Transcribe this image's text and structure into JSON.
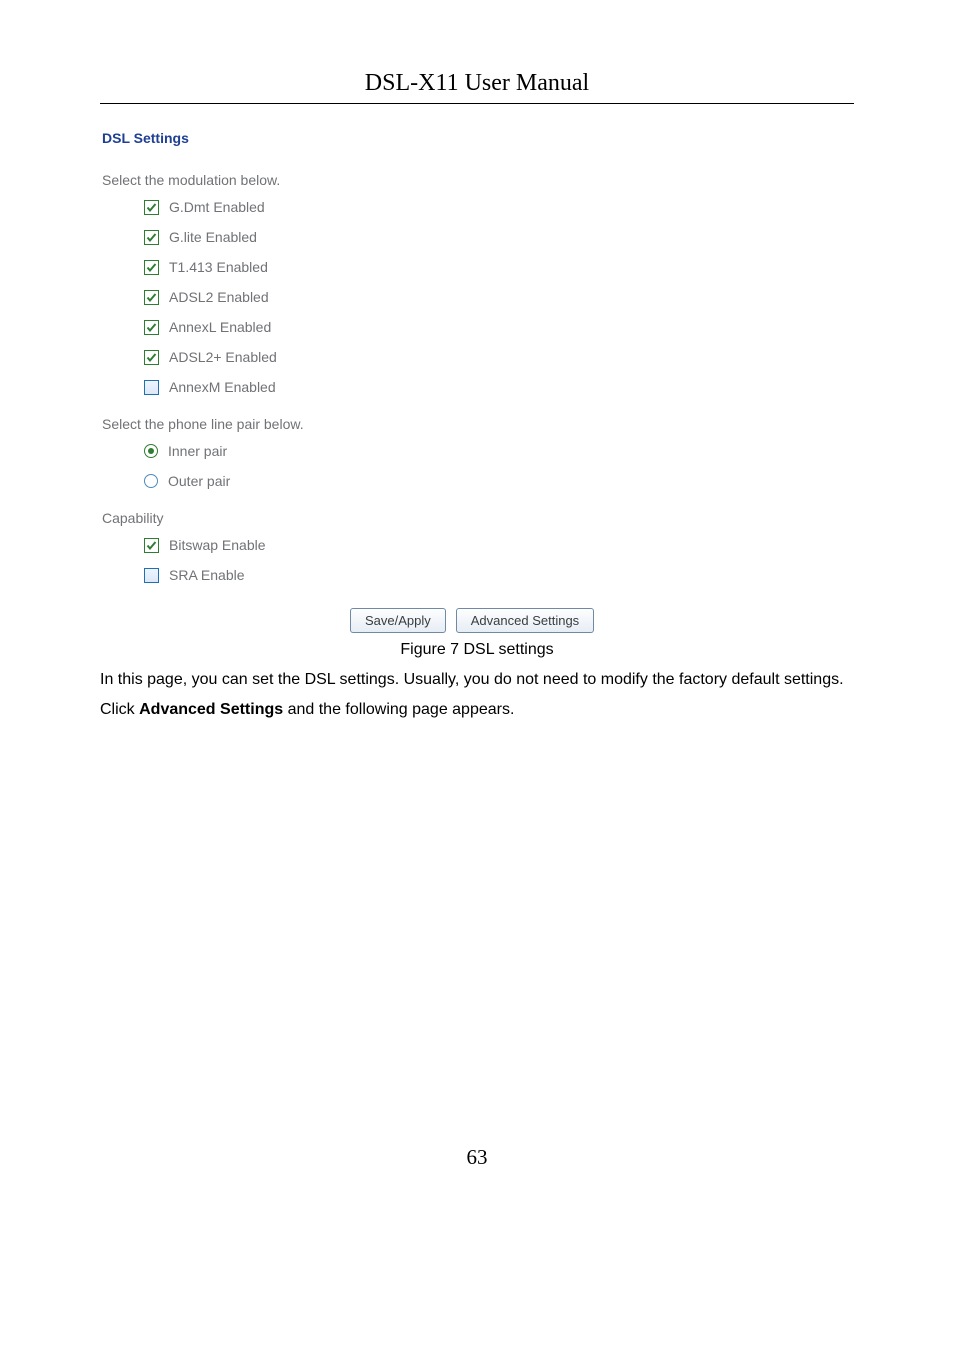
{
  "doc_header": "DSL-X11 User Manual",
  "ui": {
    "title": "DSL Settings",
    "modulation_prompt": "Select the modulation below.",
    "modulation": [
      {
        "label": "G.Dmt Enabled",
        "checked": true,
        "key": "gdmt"
      },
      {
        "label": "G.lite Enabled",
        "checked": true,
        "key": "glite"
      },
      {
        "label": "T1.413 Enabled",
        "checked": true,
        "key": "t1413"
      },
      {
        "label": "ADSL2 Enabled",
        "checked": true,
        "key": "adsl2"
      },
      {
        "label": "AnnexL Enabled",
        "checked": true,
        "key": "annexl"
      },
      {
        "label": "ADSL2+ Enabled",
        "checked": true,
        "key": "adsl2p"
      },
      {
        "label": "AnnexM Enabled",
        "checked": false,
        "key": "annexm"
      }
    ],
    "pair_prompt": "Select the phone line pair below.",
    "pairs": [
      {
        "label": "Inner pair",
        "selected": true,
        "key": "inner"
      },
      {
        "label": "Outer pair",
        "selected": false,
        "key": "outer"
      }
    ],
    "capability_label": "Capability",
    "capability": [
      {
        "label": "Bitswap Enable",
        "checked": true,
        "key": "bitswap"
      },
      {
        "label": "SRA Enable",
        "checked": false,
        "key": "sra"
      }
    ],
    "buttons": {
      "save_apply": "Save/Apply",
      "advanced": "Advanced Settings"
    }
  },
  "figure_caption": "Figure 7 DSL settings",
  "body1": "In this page, you can set the DSL settings. Usually, you do not need to modify the factory default settings.",
  "body2_pre": "Click ",
  "body2_bold": "Advanced Settings",
  "body2_post": " and the following page appears.",
  "page_number": "63",
  "icons": {
    "tick_svg": "tick-icon"
  }
}
